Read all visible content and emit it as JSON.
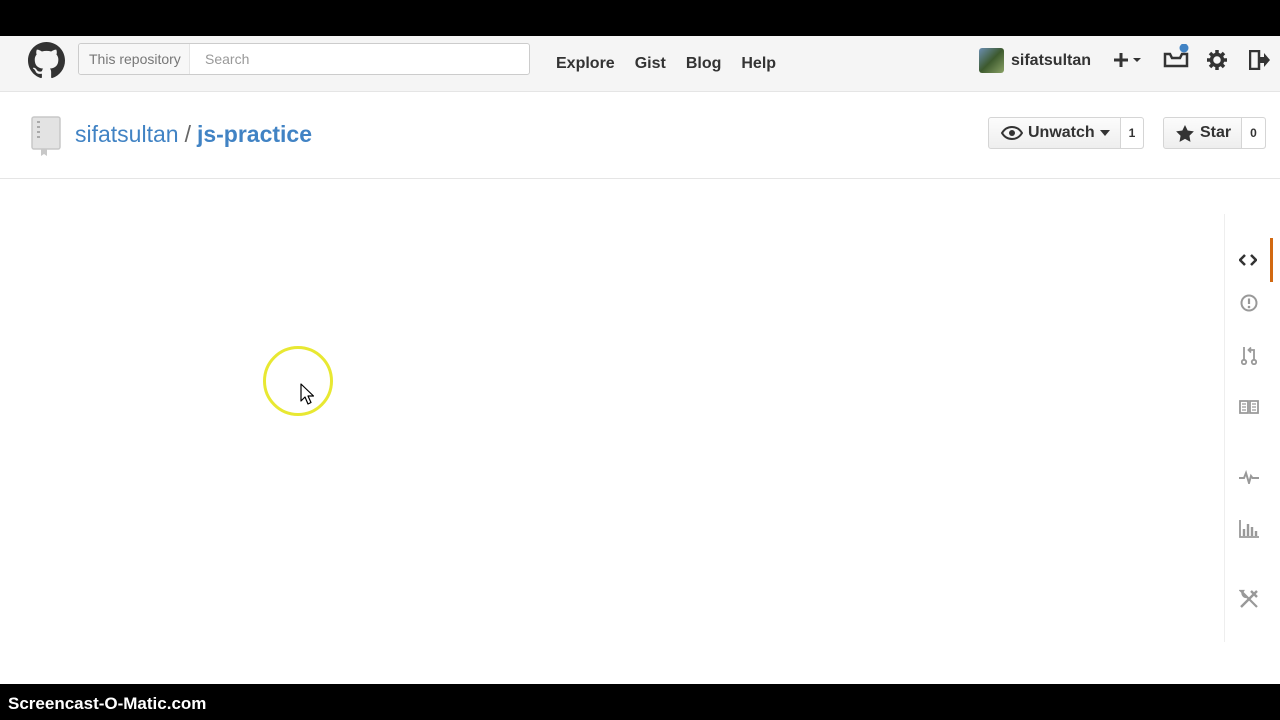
{
  "header": {
    "search_scope": "This repository",
    "search_placeholder": "Search",
    "nav": [
      "Explore",
      "Gist",
      "Blog",
      "Help"
    ],
    "username": "sifatsultan"
  },
  "repo": {
    "owner": "sifatsultan",
    "separator": "/",
    "name": "js-practice",
    "watch_label": "Unwatch",
    "watch_count": "1",
    "star_label": "Star",
    "star_count": "0"
  },
  "sidebar": {
    "items": [
      "code-icon",
      "issues-icon",
      "pull-requests-icon",
      "wiki-icon",
      "pulse-icon",
      "graphs-icon",
      "settings-icon"
    ],
    "active": "code-icon"
  },
  "colors": {
    "link": "#4183c4",
    "active_tab": "#d26911",
    "cursor_highlight": "#e8e832"
  },
  "watermark": "Screencast-O-Matic.com"
}
